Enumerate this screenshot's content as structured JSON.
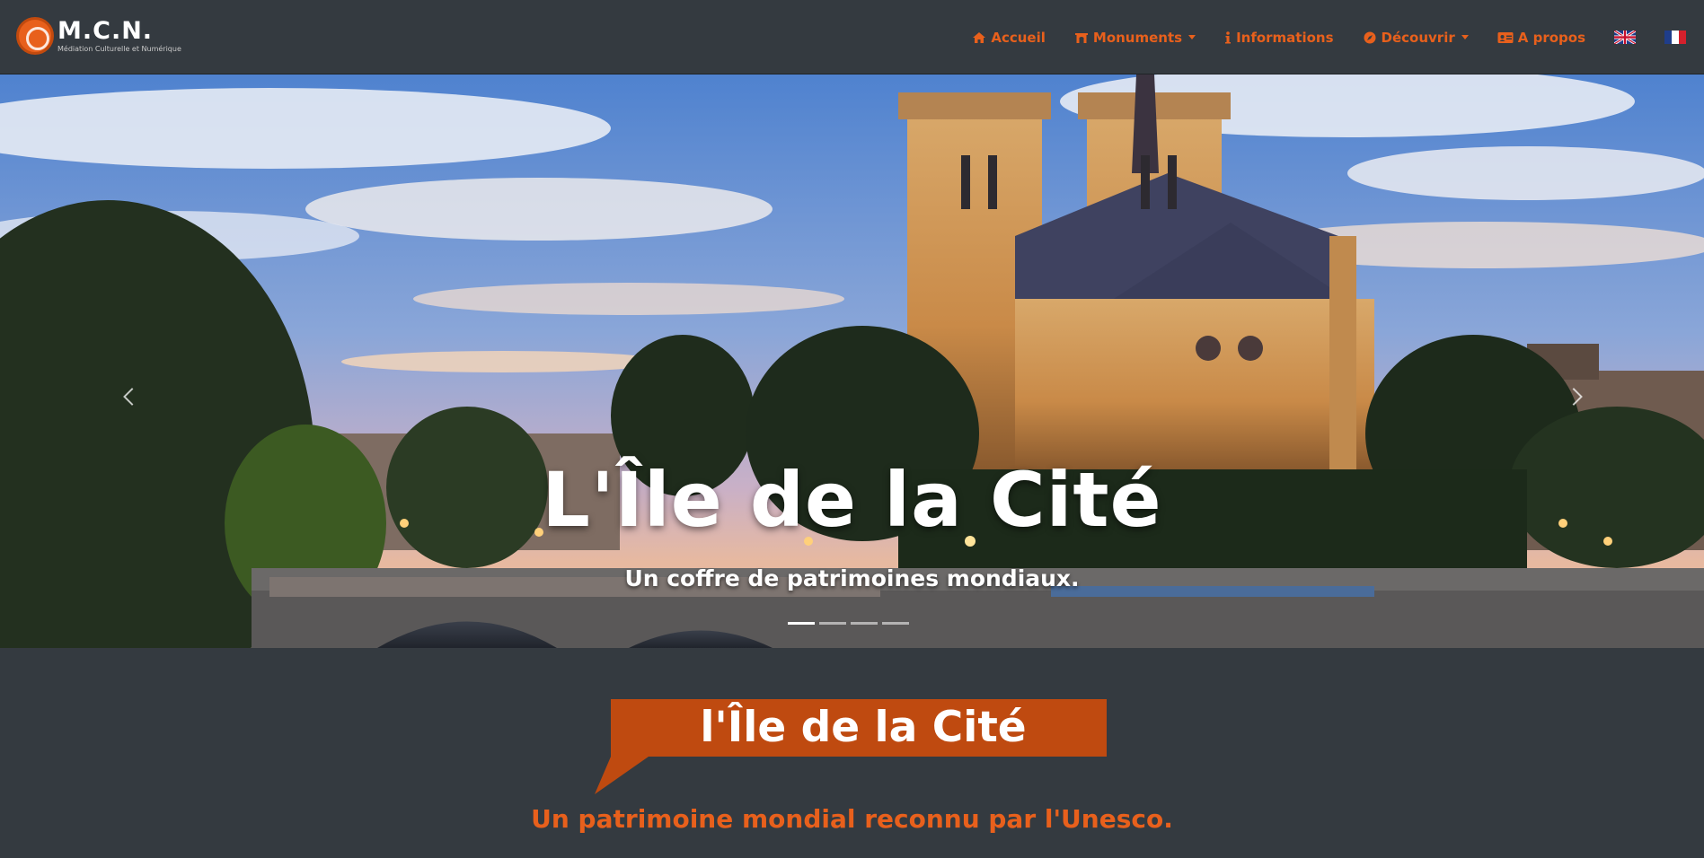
{
  "brand": {
    "name": "M.C.N.",
    "subtitle": "Médiation Culturelle et Numérique"
  },
  "nav": {
    "items": [
      {
        "label": "Accueil",
        "icon": "home-icon"
      },
      {
        "label": "Monuments",
        "icon": "monument-icon",
        "dropdown": true
      },
      {
        "label": "Informations",
        "icon": "info-icon"
      },
      {
        "label": "Découvrir",
        "icon": "compass-icon",
        "dropdown": true
      },
      {
        "label": "A propos",
        "icon": "id-card-icon"
      }
    ],
    "languages": [
      "english-flag",
      "french-flag"
    ]
  },
  "hero": {
    "title": "L'Île de la Cité",
    "subtitle": "Un coffre de patrimoines mondiaux.",
    "slide_count": 4,
    "active_slide": 1
  },
  "section": {
    "heading": "l'Île de la Cité",
    "tagline": "Un patrimoine mondial reconnu par l'Unesco."
  },
  "colors": {
    "accent": "#e8601c",
    "ribbon": "#bf4a10",
    "navbar": "#343a40"
  }
}
